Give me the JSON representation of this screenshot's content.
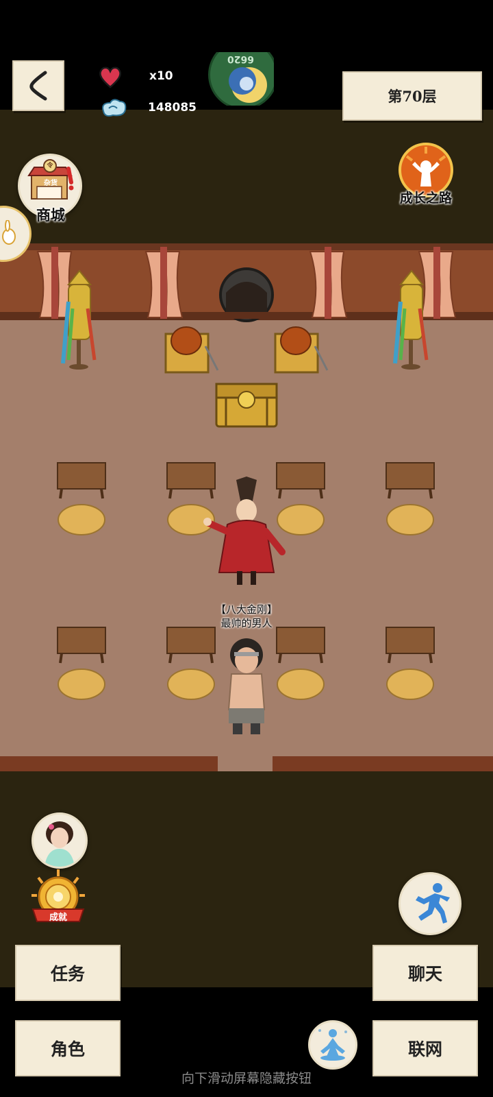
{
  "hud": {
    "lives_value": "x10",
    "coins_value": "148085",
    "floor_label": "第70层",
    "top_avatar_number": "6620"
  },
  "side_buttons": {
    "shop_label": "商城",
    "shop_sign_top": "令",
    "shop_sign_text": "杂货",
    "growth_label": "成长之路",
    "achievement_label": "成就"
  },
  "npc": {
    "title": "【八大金刚】",
    "name": "最帅的男人"
  },
  "bottom_buttons": {
    "task": "任务",
    "role": "角色",
    "chat": "聊天",
    "network": "联网"
  },
  "hint": "向下滑动屏幕隐藏按钮",
  "colors": {
    "room_floor": "#a47f6b",
    "dark_band": "#2b2410",
    "paper": "#f4ecd8",
    "heart": "#d9364f",
    "growth_orange": "#e0631a"
  }
}
